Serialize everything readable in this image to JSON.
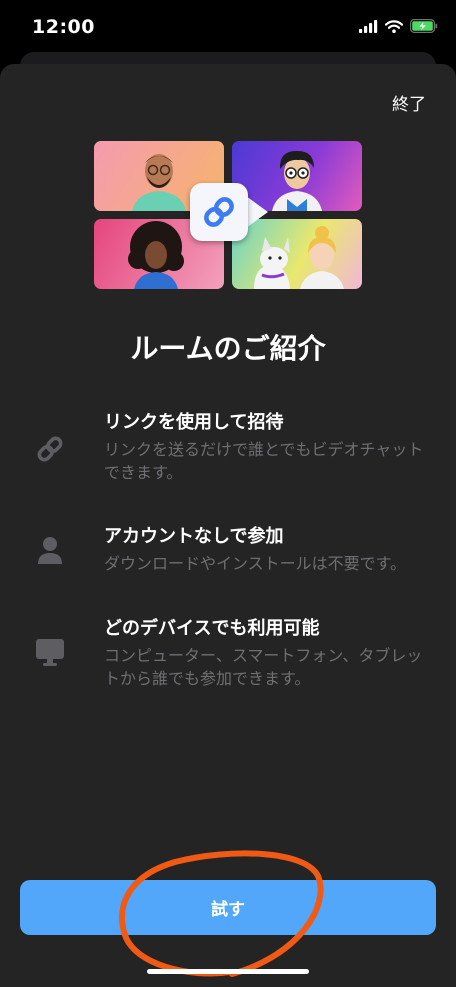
{
  "status_bar": {
    "time": "12:00",
    "icons": [
      "signal-icon",
      "wifi-icon",
      "battery-charging-icon"
    ],
    "battery_color": "#4cd964"
  },
  "header": {
    "done_label": "終了"
  },
  "hero": {
    "icon": "video-link-icon",
    "accent": "#3c7bf0"
  },
  "title": "ルームのご紹介",
  "features": [
    {
      "icon": "link-icon",
      "title": "リンクを使用して招待",
      "description": "リンクを送るだけで誰とでもビデオチャットできます。"
    },
    {
      "icon": "person-icon",
      "title": "アカウントなしで参加",
      "description": "ダウンロードやインストールは不要です。"
    },
    {
      "icon": "monitor-icon",
      "title": "どのデバイスでも利用可能",
      "description": "コンピューター、スマートフォン、タブレットから誰でも参加できます。"
    }
  ],
  "primary_action": {
    "label": "試す",
    "color": "#52a7fb"
  },
  "annotation_color": "#f05a14"
}
